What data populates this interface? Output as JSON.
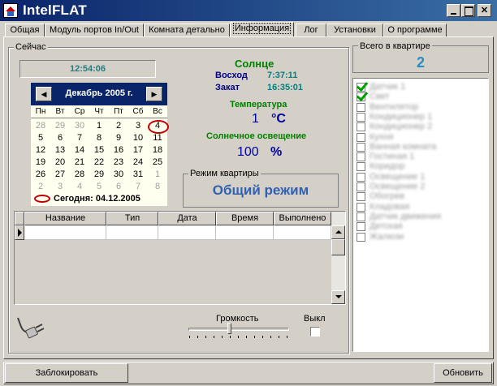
{
  "window": {
    "title": "IntelFLAT"
  },
  "tabs": [
    {
      "label": "Общая"
    },
    {
      "label": "Модуль портов In/Out"
    },
    {
      "label": "Комната детально"
    },
    {
      "label": "Информация"
    },
    {
      "label": "Лог"
    },
    {
      "label": "Установки"
    },
    {
      "label": "О программе"
    }
  ],
  "now": {
    "group_label": "Сейчас",
    "time": "12:54:06"
  },
  "calendar": {
    "month_label": "Декабрь 2005 г.",
    "weekdays": [
      "Пн",
      "Вт",
      "Ср",
      "Чт",
      "Пт",
      "Сб",
      "Вс"
    ],
    "weeks": [
      [
        "28",
        "29",
        "30",
        "1",
        "2",
        "3",
        "4"
      ],
      [
        "5",
        "6",
        "7",
        "8",
        "9",
        "10",
        "11"
      ],
      [
        "12",
        "13",
        "14",
        "15",
        "16",
        "17",
        "18"
      ],
      [
        "19",
        "20",
        "21",
        "22",
        "23",
        "24",
        "25"
      ],
      [
        "26",
        "27",
        "28",
        "29",
        "30",
        "31",
        "1"
      ],
      [
        "2",
        "3",
        "4",
        "5",
        "6",
        "7",
        "8"
      ]
    ],
    "today_label": "Сегодня: 04.12.2005"
  },
  "sun": {
    "title": "Солнце",
    "sunrise_label": "Восход",
    "sunrise": "7:37:11",
    "sunset_label": "Закат",
    "sunset": "16:35:01"
  },
  "temperature": {
    "title": "Температура",
    "value": "1",
    "unit": "°C"
  },
  "light": {
    "title": "Солнечное освещение",
    "value": "100",
    "unit": "%"
  },
  "mode": {
    "group_label": "Режим квартиры",
    "value": "Общий режим"
  },
  "table": {
    "columns": [
      "Название",
      "Тип",
      "Дата",
      "Время",
      "Выполнено"
    ]
  },
  "volume": {
    "label": "Громкость",
    "level": 0.4,
    "mute_label": "Выкл"
  },
  "apartment": {
    "total_label": "Всего в квартире",
    "total": "2",
    "items": [
      {
        "label": "Датчик 1",
        "checked": true
      },
      {
        "label": "Свет",
        "checked": true
      },
      {
        "label": "Вентилятор",
        "checked": false
      },
      {
        "label": "Кондиционер 1",
        "checked": false
      },
      {
        "label": "Кондиционер 2",
        "checked": false
      },
      {
        "label": "Кухня",
        "checked": false
      },
      {
        "label": "Ванная комната",
        "checked": false
      },
      {
        "label": "Гостиная 1",
        "checked": false
      },
      {
        "label": "Коридор",
        "checked": false
      },
      {
        "label": "Освещение 1",
        "checked": false
      },
      {
        "label": "Освещение 2",
        "checked": false
      },
      {
        "label": "Обогрев",
        "checked": false
      },
      {
        "label": "Кладовая",
        "checked": false
      },
      {
        "label": "Датчик движения",
        "checked": false
      },
      {
        "label": "Детская",
        "checked": false
      },
      {
        "label": "Жалюзи",
        "checked": false
      }
    ]
  },
  "buttons": {
    "lock": "Заблокировать",
    "refresh": "Обновить"
  }
}
